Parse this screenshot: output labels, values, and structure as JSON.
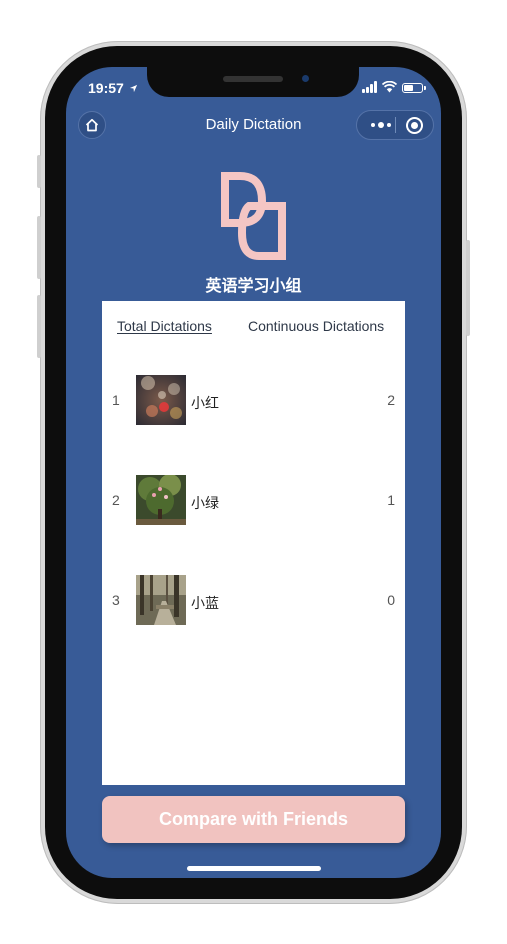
{
  "status_bar": {
    "time": "19:57"
  },
  "nav": {
    "title": "Daily Dictation"
  },
  "group": {
    "name": "英语学习小组",
    "logo_color": "#f4c6c4"
  },
  "tabs": [
    {
      "label": "Total Dictations",
      "active": true
    },
    {
      "label": "Continuous Dictations",
      "active": false
    }
  ],
  "leaderboard": [
    {
      "rank": "1",
      "name": "小红",
      "score": "2"
    },
    {
      "rank": "2",
      "name": "小绿",
      "score": "1"
    },
    {
      "rank": "3",
      "name": "小蓝",
      "score": "0"
    }
  ],
  "compare_button": {
    "label": "Compare with Friends"
  },
  "colors": {
    "background": "#385b97",
    "button": "#f1c3c0",
    "card": "#ffffff"
  }
}
